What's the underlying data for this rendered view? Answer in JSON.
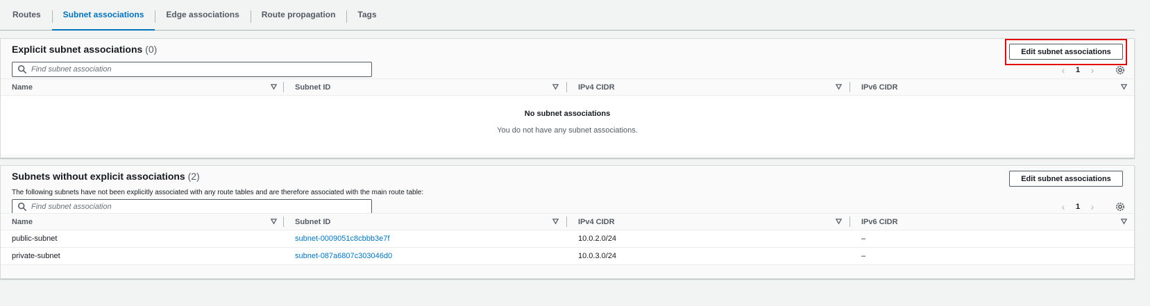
{
  "tabs": [
    {
      "label": "Routes",
      "active": false
    },
    {
      "label": "Subnet associations",
      "active": true
    },
    {
      "label": "Edge associations",
      "active": false
    },
    {
      "label": "Route propagation",
      "active": false
    },
    {
      "label": "Tags",
      "active": false
    }
  ],
  "explicit": {
    "title": "Explicit subnet associations",
    "count": "(0)",
    "button": "Edit subnet associations",
    "search_placeholder": "Find subnet association",
    "page": "1",
    "columns": [
      "Name",
      "Subnet ID",
      "IPv4 CIDR",
      "IPv6 CIDR"
    ],
    "empty_title": "No subnet associations",
    "empty_message": "You do not have any subnet associations."
  },
  "implicit": {
    "title": "Subnets without explicit associations",
    "count": "(2)",
    "description": "The following subnets have not been explicitly associated with any route tables and are therefore associated with the main route table:",
    "button": "Edit subnet associations",
    "search_placeholder": "Find subnet association",
    "page": "1",
    "columns": [
      "Name",
      "Subnet ID",
      "IPv4 CIDR",
      "IPv6 CIDR"
    ],
    "rows": [
      {
        "name": "public-subnet",
        "subnet_id": "subnet-0009051c8cbbb3e7f",
        "ipv4": "10.0.2.0/24",
        "ipv6": "–"
      },
      {
        "name": "private-subnet",
        "subnet_id": "subnet-087a6807c303046d0",
        "ipv4": "10.0.3.0/24",
        "ipv6": "–"
      }
    ]
  },
  "colors": {
    "accent": "#0073bb",
    "highlight": "#e00000"
  }
}
